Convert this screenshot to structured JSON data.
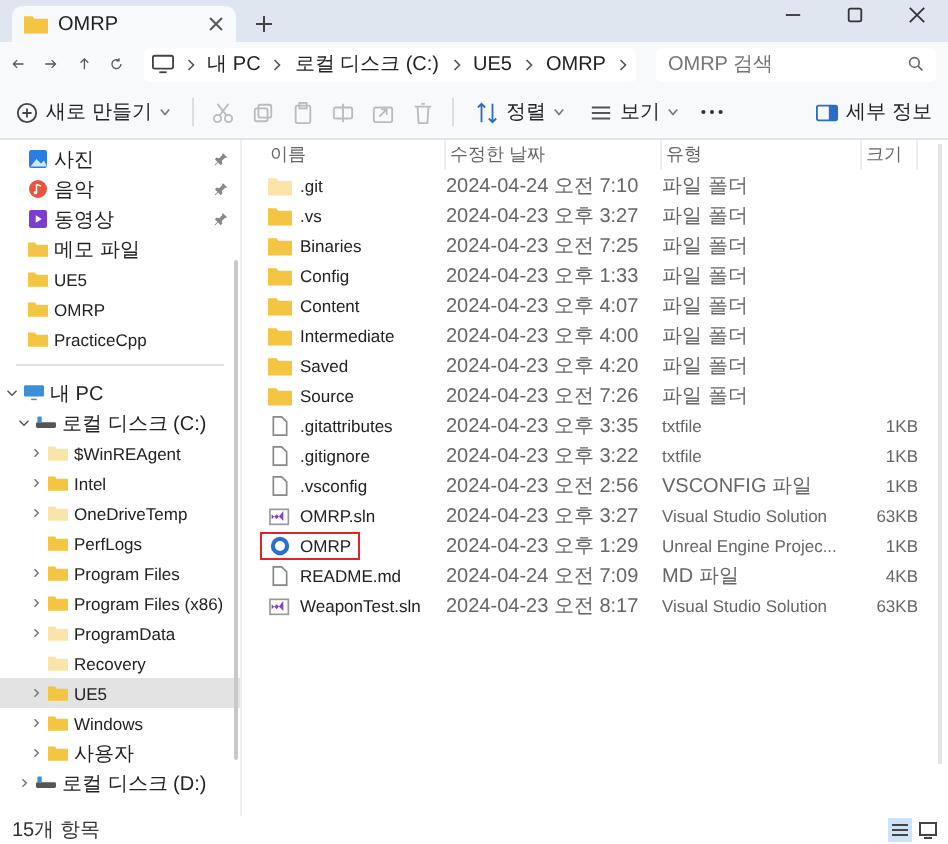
{
  "tab": {
    "title": "OMRP"
  },
  "breadcrumb": [
    "내 PC",
    "로컬 디스크 (C:)",
    "UE5",
    "OMRP"
  ],
  "search": {
    "placeholder": "OMRP 검색"
  },
  "toolbar": {
    "new_label": "새로 만들기",
    "sort_label": "정렬",
    "view_label": "보기",
    "details_label": "세부 정보"
  },
  "quick_access": [
    {
      "label": "사진",
      "kind": "pictures",
      "pinned": true
    },
    {
      "label": "음악",
      "kind": "music",
      "pinned": true
    },
    {
      "label": "동영상",
      "kind": "video",
      "pinned": true
    },
    {
      "label": "메모 파일",
      "kind": "folder",
      "pinned": false
    },
    {
      "label": "UE5",
      "kind": "folder",
      "pinned": false
    },
    {
      "label": "OMRP",
      "kind": "folder",
      "pinned": false
    },
    {
      "label": "PracticeCpp",
      "kind": "folder",
      "pinned": false
    }
  ],
  "tree": [
    {
      "label": "내 PC",
      "kind": "pc",
      "expandable": true,
      "expanded": true,
      "hidden": false,
      "selected": false,
      "children": [
        {
          "label": "로컬 디스크 (C:)",
          "kind": "drive",
          "expandable": true,
          "expanded": true,
          "hidden": false,
          "selected": false,
          "children": [
            {
              "label": "$WinREAgent",
              "kind": "folder",
              "expandable": true,
              "expanded": false,
              "hidden": true,
              "selected": false
            },
            {
              "label": "Intel",
              "kind": "folder",
              "expandable": true,
              "expanded": false,
              "hidden": false,
              "selected": false
            },
            {
              "label": "OneDriveTemp",
              "kind": "folder",
              "expandable": true,
              "expanded": false,
              "hidden": true,
              "selected": false
            },
            {
              "label": "PerfLogs",
              "kind": "folder",
              "expandable": false,
              "hidden": false,
              "selected": false
            },
            {
              "label": "Program Files",
              "kind": "folder",
              "expandable": true,
              "expanded": false,
              "hidden": false,
              "selected": false
            },
            {
              "label": "Program Files (x86)",
              "kind": "folder",
              "expandable": true,
              "expanded": false,
              "hidden": false,
              "selected": false
            },
            {
              "label": "ProgramData",
              "kind": "folder",
              "expandable": true,
              "expanded": false,
              "hidden": true,
              "selected": false
            },
            {
              "label": "Recovery",
              "kind": "folder",
              "expandable": false,
              "hidden": true,
              "selected": false
            },
            {
              "label": "UE5",
              "kind": "folder",
              "expandable": true,
              "expanded": false,
              "hidden": false,
              "selected": true
            },
            {
              "label": "Windows",
              "kind": "folder",
              "expandable": true,
              "expanded": false,
              "hidden": false,
              "selected": false
            },
            {
              "label": "사용자",
              "kind": "folder",
              "expandable": true,
              "expanded": false,
              "hidden": false,
              "selected": false
            }
          ]
        },
        {
          "label": "로컬 디스크 (D:)",
          "kind": "drive",
          "expandable": true,
          "expanded": false,
          "hidden": false,
          "selected": false
        }
      ]
    }
  ],
  "columns": [
    "이름",
    "수정한 날짜",
    "유형",
    "크기"
  ],
  "files": [
    {
      "name": ".git",
      "kind": "folder",
      "hidden": true,
      "boxed": false,
      "date": "2024-04-24 오전 7:10",
      "type": "파일 폴더"
    },
    {
      "name": ".vs",
      "kind": "folder",
      "hidden": false,
      "boxed": false,
      "date": "2024-04-23 오후 3:27",
      "type": "파일 폴더"
    },
    {
      "name": "Binaries",
      "kind": "folder",
      "hidden": false,
      "boxed": false,
      "date": "2024-04-23 오전 7:25",
      "type": "파일 폴더"
    },
    {
      "name": "Config",
      "kind": "folder",
      "hidden": false,
      "boxed": false,
      "date": "2024-04-23 오후 1:33",
      "type": "파일 폴더"
    },
    {
      "name": "Content",
      "kind": "folder",
      "hidden": false,
      "boxed": false,
      "date": "2024-04-23 오후 4:07",
      "type": "파일 폴더"
    },
    {
      "name": "Intermediate",
      "kind": "folder",
      "hidden": false,
      "boxed": false,
      "date": "2024-04-23 오후 4:00",
      "type": "파일 폴더"
    },
    {
      "name": "Saved",
      "kind": "folder",
      "hidden": false,
      "boxed": false,
      "date": "2024-04-23 오후 4:20",
      "type": "파일 폴더"
    },
    {
      "name": "Source",
      "kind": "folder",
      "hidden": false,
      "boxed": false,
      "date": "2024-04-23 오전 7:26",
      "type": "파일 폴더"
    },
    {
      "name": ".gitattributes",
      "kind": "file",
      "hidden": false,
      "boxed": false,
      "date": "2024-04-23 오후 3:35",
      "type": "txtfile",
      "size": "1KB"
    },
    {
      "name": ".gitignore",
      "kind": "file",
      "hidden": false,
      "boxed": false,
      "date": "2024-04-23 오후 3:22",
      "type": "txtfile",
      "size": "1KB"
    },
    {
      "name": ".vsconfig",
      "kind": "file",
      "hidden": false,
      "boxed": false,
      "date": "2024-04-23 오전 2:56",
      "type": "VSCONFIG 파일",
      "size": "1KB"
    },
    {
      "name": "OMRP.sln",
      "kind": "solution",
      "hidden": false,
      "boxed": false,
      "date": "2024-04-23 오후 3:27",
      "type": "Visual Studio Solution",
      "size": "63KB"
    },
    {
      "name": "OMRP",
      "kind": "uproject",
      "hidden": false,
      "boxed": true,
      "date": "2024-04-23 오후 1:29",
      "type": "Unreal Engine Projec...",
      "size": "1KB"
    },
    {
      "name": "README.md",
      "kind": "file",
      "hidden": false,
      "boxed": false,
      "date": "2024-04-24 오전 7:09",
      "type": "MD 파일",
      "size": "4KB"
    },
    {
      "name": "WeaponTest.sln",
      "kind": "solution",
      "hidden": false,
      "boxed": false,
      "date": "2024-04-23 오전 8:17",
      "type": "Visual Studio Solution",
      "size": "63KB"
    }
  ],
  "status": {
    "count": "15개 항목"
  },
  "view_modes": [
    {
      "kind": "details",
      "selected": true
    },
    {
      "kind": "tiles",
      "selected": false
    }
  ]
}
